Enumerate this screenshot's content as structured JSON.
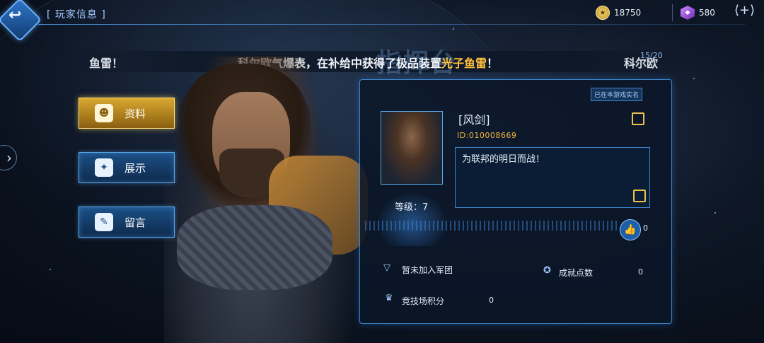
{
  "header": {
    "title": "[ 玩家信息 ]",
    "coins": "18750",
    "gems": "580"
  },
  "ticker": {
    "left_fragment": "鱼雷！",
    "main_prefix": "科尔欧气爆表，在补给中获得了极品装置",
    "highlight_item": "光子鱼雷",
    "main_suffix": "！",
    "right_fragment": "科尔欧",
    "background_word": "指挥台",
    "counter": "15/20"
  },
  "menu": {
    "items": [
      {
        "label": "资料",
        "active": true
      },
      {
        "label": "展示",
        "active": false
      },
      {
        "label": "留言",
        "active": false
      }
    ]
  },
  "profile": {
    "verified_badge": "已在本游戏实名",
    "name": "[风剑]",
    "id": "ID:010008669",
    "signature": "为联邦的明日而战！",
    "level": "等级：7",
    "likes": "0"
  },
  "stats": {
    "legion": {
      "label": "暂未加入军团"
    },
    "achievement": {
      "label": "成就点数",
      "value": "0"
    },
    "arena": {
      "label": "竞技场积分",
      "value": "0"
    }
  },
  "colors": {
    "accent_blue": "#3f84c8",
    "gold": "#f0c14a",
    "highlight": "#ffc13b"
  }
}
